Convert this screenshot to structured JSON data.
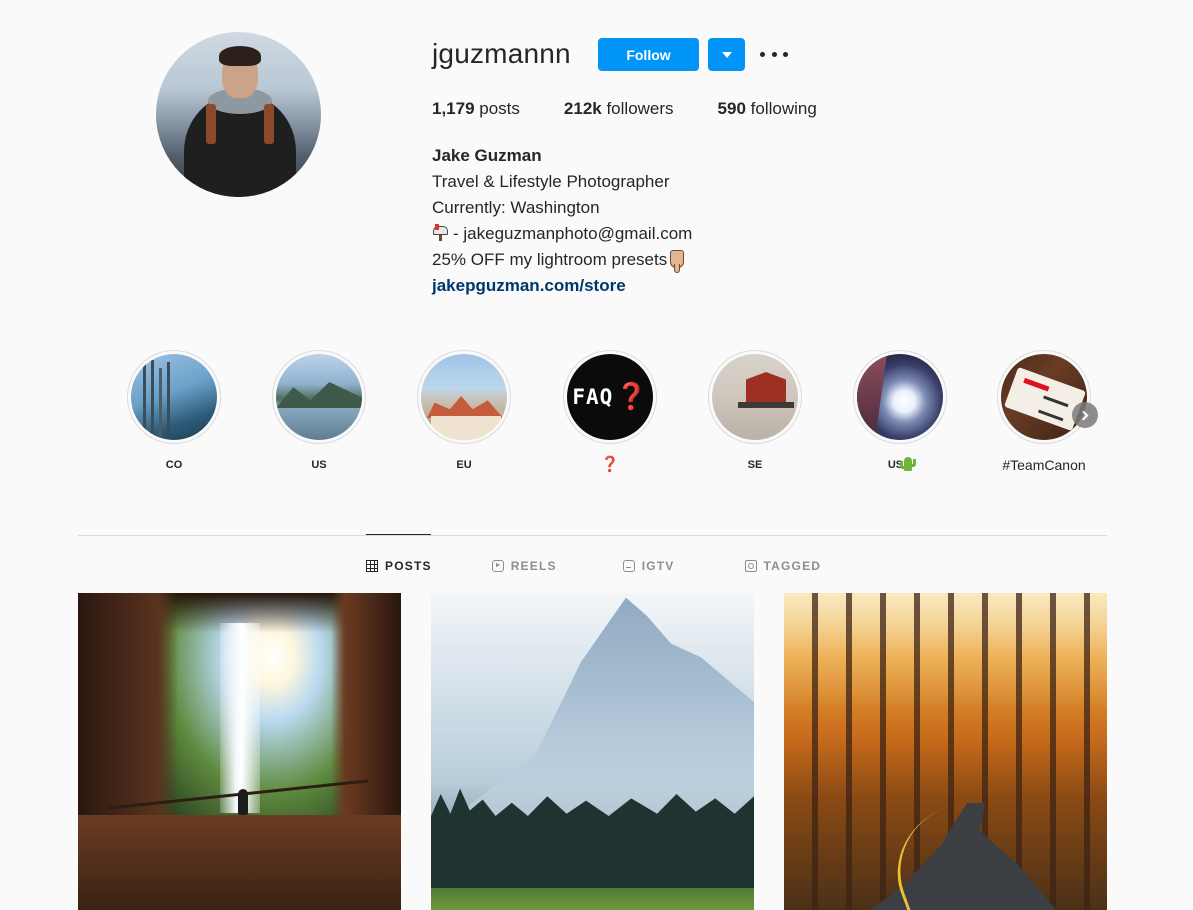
{
  "profile": {
    "username": "jguzmannn",
    "follow_label": "Follow",
    "stats": {
      "posts_count": "1,179",
      "posts_label": " posts",
      "followers_count": "212k",
      "followers_label": " followers",
      "following_count": "590",
      "following_label": " following"
    },
    "bio": {
      "name": "Jake Guzman",
      "line1": "Travel & Lifestyle Photographer",
      "line2": "Currently: Washington",
      "email_prefix": "- ",
      "email": "jakeguzmanphoto@gmail.com",
      "promo": "25% OFF my lightroom presets",
      "link": "jakepguzman.com/store"
    }
  },
  "icons": {
    "mailbox": "mailbox-emoji",
    "hand": "pointing-down-emoji",
    "cactus": "cactus-emoji",
    "question": "red-question-mark-emoji"
  },
  "highlights": [
    {
      "label": "CO"
    },
    {
      "label": "US"
    },
    {
      "label": "EU"
    },
    {
      "label": "❓",
      "cover_text": "FAQ",
      "cover_mark": "❓"
    },
    {
      "label": "SE"
    },
    {
      "label": "US"
    },
    {
      "label": "#TeamCanon"
    }
  ],
  "tabs": [
    {
      "label": "POSTS",
      "active": true
    },
    {
      "label": "REELS",
      "active": false
    },
    {
      "label": "IGTV",
      "active": false
    },
    {
      "label": "TAGGED",
      "active": false
    }
  ],
  "colors": {
    "accent": "#0095f6",
    "link": "#00376b",
    "text": "#262626",
    "muted": "#8e8e8e",
    "background": "#fafafa"
  }
}
